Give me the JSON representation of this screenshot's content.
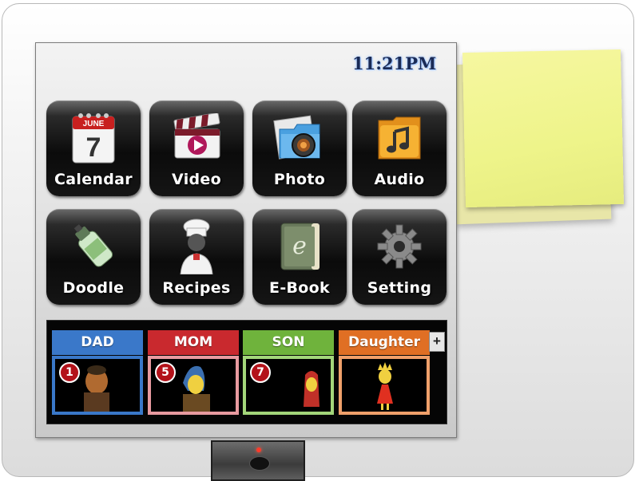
{
  "clock": {
    "time": "11:21PM"
  },
  "apps": [
    {
      "label": "Calendar",
      "icon": "calendar-icon",
      "month": "JUNE",
      "day": "7"
    },
    {
      "label": "Video",
      "icon": "video-clapper-icon"
    },
    {
      "label": "Photo",
      "icon": "photo-folder-icon"
    },
    {
      "label": "Audio",
      "icon": "audio-folder-icon"
    },
    {
      "label": "Doodle",
      "icon": "glue-bottle-icon"
    },
    {
      "label": "Recipes",
      "icon": "chef-icon"
    },
    {
      "label": "E-Book",
      "icon": "ebook-icon",
      "glyph": "e"
    },
    {
      "label": "Setting",
      "icon": "gear-icon"
    }
  ],
  "family": {
    "members": [
      {
        "name": "DAD",
        "count": "1",
        "color": "#3a78c9",
        "avatar": "dad-avatar"
      },
      {
        "name": "MOM",
        "count": "5",
        "color": "#c9292e",
        "avatar": "mom-avatar"
      },
      {
        "name": "SON",
        "count": "7",
        "color": "#6fb33c",
        "avatar": "son-avatar"
      },
      {
        "name": "Daughter",
        "count": "",
        "color": "#e06f24",
        "avatar": "daughter-avatar"
      }
    ],
    "add_label": "+"
  },
  "sticky_note": {
    "color": "#f3f58f"
  }
}
